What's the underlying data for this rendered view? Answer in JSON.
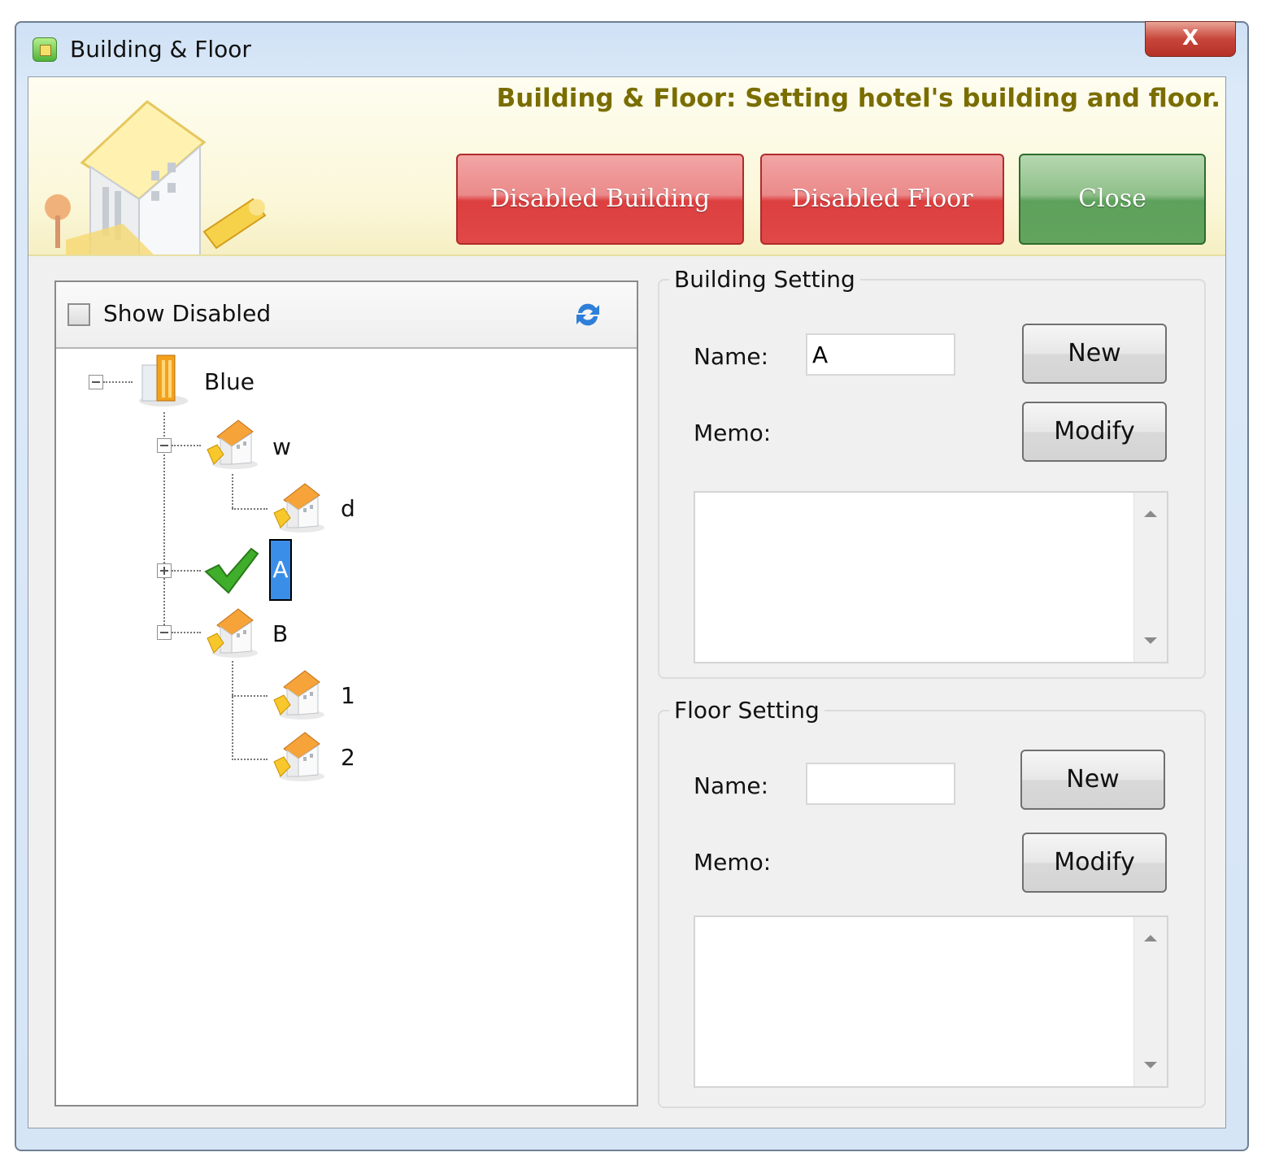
{
  "window": {
    "title": "Building & Floor",
    "close_glyph": "X"
  },
  "banner": {
    "text": "Building & Floor: Setting hotel's building and floor.",
    "buttons": {
      "disabled_building": "Disabled Building",
      "disabled_floor": "Disabled Floor",
      "close": "Close"
    }
  },
  "tree_panel": {
    "show_disabled_label": "Show Disabled",
    "show_disabled_checked": false,
    "refresh_icon": "refresh-icon",
    "nodes": {
      "root": "Blue",
      "w": "w",
      "d": "d",
      "a": "A",
      "b": "B",
      "one": "1",
      "two": "2"
    }
  },
  "building_setting": {
    "legend": "Building Setting",
    "name_label": "Name:",
    "name_value": "A",
    "memo_label": "Memo:",
    "new_label": "New",
    "modify_label": "Modify"
  },
  "floor_setting": {
    "legend": "Floor Setting",
    "name_label": "Name:",
    "name_value": "",
    "memo_label": "Memo:",
    "new_label": "New",
    "modify_label": "Modify"
  },
  "colors": {
    "banner_text": "#7a6d00",
    "disabled_btn": "#e04848",
    "close_btn": "#5ea15c",
    "selection": "#3a8ee8"
  }
}
